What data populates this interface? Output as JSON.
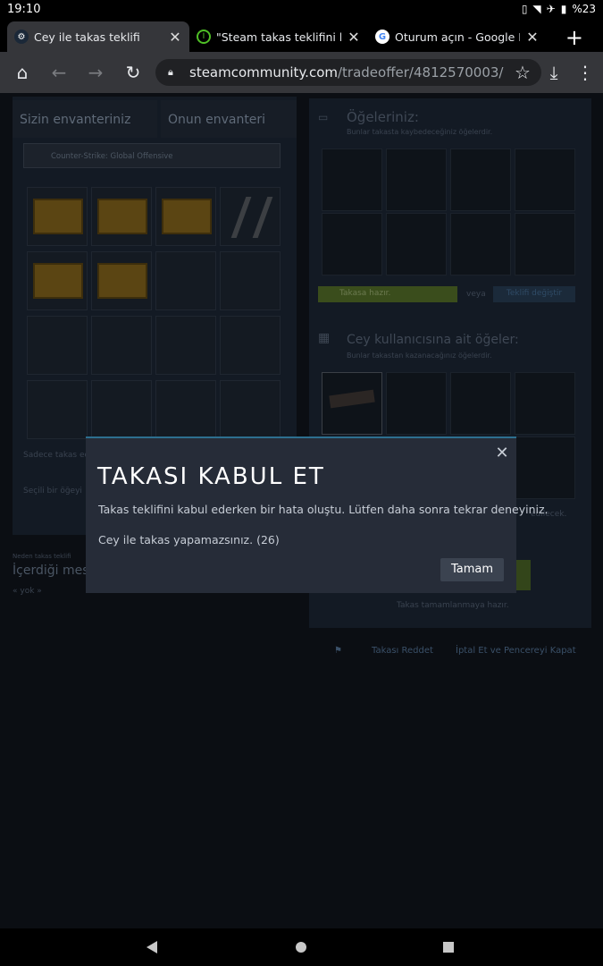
{
  "status_bar": {
    "time": "19:10",
    "battery": "%23",
    "icons": [
      "vibrate-icon",
      "wifi-icon",
      "airplane-icon",
      "battery-icon"
    ]
  },
  "browser": {
    "tabs": [
      {
        "title": "Cey ile takas teklifi",
        "favicon": "steam-icon",
        "active": true
      },
      {
        "title": "\"Steam takas teklifini kabul e",
        "favicon": "power-icon",
        "active": false
      },
      {
        "title": "Oturum açın - Google Hesap",
        "favicon": "google-icon",
        "active": false
      }
    ],
    "new_tab": "+",
    "url_host": "steamcommunity.com",
    "url_path": "/tradeoffer/4812570003/"
  },
  "page": {
    "inventory_tabs": [
      "Sizin envanteriniz",
      "Onun envanteri"
    ],
    "game_select": "Counter-Strike: Global Offensive",
    "your_items_title": "Öğeleriniz:",
    "your_items_sub": "Bunlar takasta kaybedeceğiniz öğelerdir.",
    "ready_label": "Takasa hazır.",
    "or_label": "veya",
    "change_offer": "Teklifi değiştir",
    "their_items_title": "Cey kullanıcısına ait öğeler:",
    "their_items_sub": "Bunlar takastan kazanacağınız öğelerdir.",
    "why_label": "Neden takas teklifi",
    "message_label": "İçerdiği mes",
    "none_label": "« yok »",
    "only_trade": "Sadece takas edi",
    "select_item": "Seçili bir öğeyi",
    "will_receive": "edilecek.",
    "not_complete": "Takas tamamlanmaya hazır.",
    "decline": "Takası Reddet",
    "cancel_close": "İptal Et ve Pencereyi Kapat"
  },
  "modal": {
    "title": "TAKASI KABUL ET",
    "message": "Takas teklifini kabul ederken bir hata oluştu. Lütfen daha sonra tekrar deneyiniz.",
    "detail": "Cey ile takas yapamazsınız. (26)",
    "ok_label": "Tamam",
    "close": "✕"
  }
}
